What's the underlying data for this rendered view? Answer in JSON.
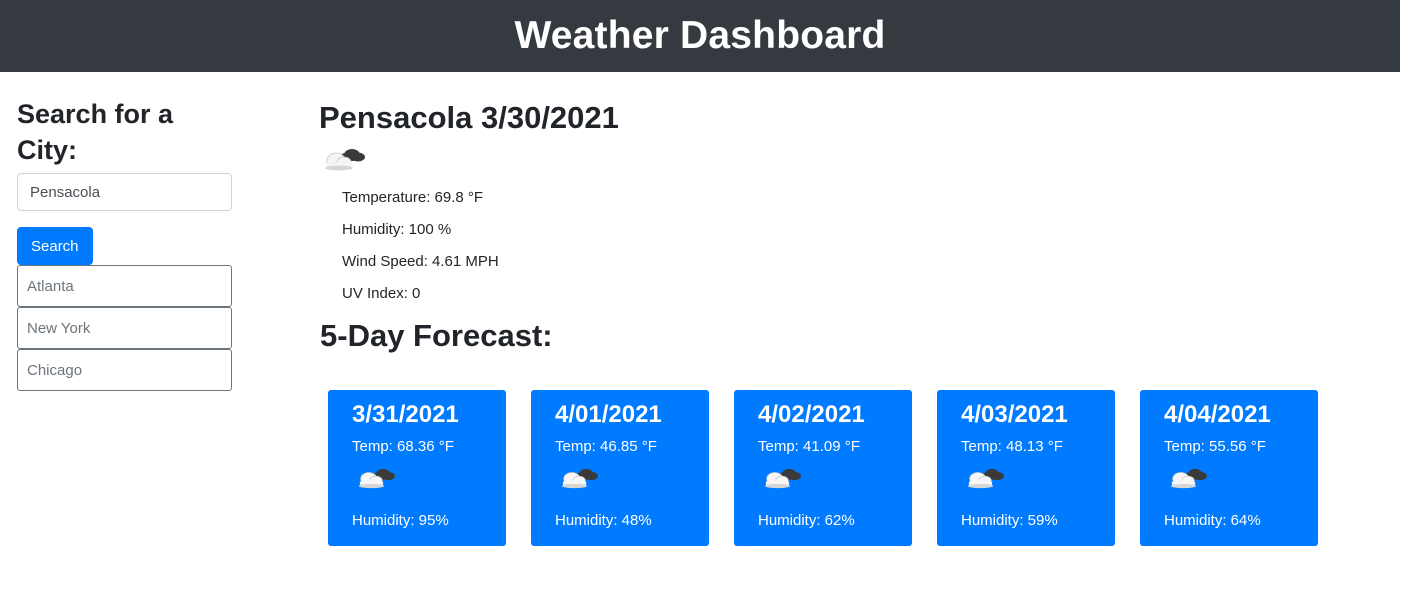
{
  "header": {
    "title": "Weather Dashboard"
  },
  "search": {
    "heading": "Search for a City:",
    "input_value": "Pensacola",
    "button_label": "Search",
    "history": [
      "Atlanta",
      "New York",
      "Chicago"
    ]
  },
  "current": {
    "title": "Pensacola 3/30/2021",
    "icon": "cloudy-icon",
    "temperature": "Temperature: 69.8 °F",
    "humidity": "Humidity: 100 %",
    "wind": "Wind Speed: 4.61 MPH",
    "uv": "UV Index: 0"
  },
  "forecast": {
    "heading": "5-Day Forecast:",
    "days": [
      {
        "date": "3/31/2021",
        "temp": "Temp: 68.36 °F",
        "icon": "cloudy-icon",
        "humidity": "Humidity: 95%"
      },
      {
        "date": "4/01/2021",
        "temp": "Temp: 46.85 °F",
        "icon": "cloudy-icon",
        "humidity": "Humidity: 48%"
      },
      {
        "date": "4/02/2021",
        "temp": "Temp: 41.09 °F",
        "icon": "cloudy-icon",
        "humidity": "Humidity: 62%"
      },
      {
        "date": "4/03/2021",
        "temp": "Temp: 48.13 °F",
        "icon": "cloudy-icon",
        "humidity": "Humidity: 59%"
      },
      {
        "date": "4/04/2021",
        "temp": "Temp: 55.56 °F",
        "icon": "cloudy-icon",
        "humidity": "Humidity: 64%"
      }
    ]
  },
  "colors": {
    "header_bg": "#343a40",
    "accent": "#007bff",
    "history_border": "#6c757d"
  }
}
